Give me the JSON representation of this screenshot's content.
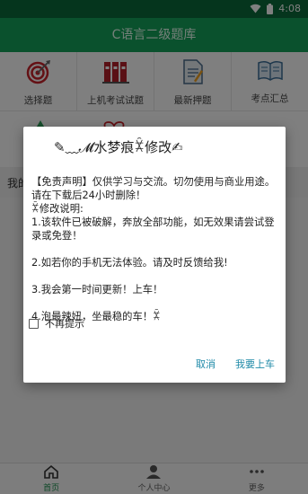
{
  "status_bar": {
    "time": "4:08"
  },
  "app_bar": {
    "title": "C语言二级题库"
  },
  "grid": [
    {
      "label": "选择题",
      "icon": "target-icon"
    },
    {
      "label": "上机考试试题",
      "icon": "books-icon"
    },
    {
      "label": "最新押题",
      "icon": "document-icon"
    },
    {
      "label": "考点汇总",
      "icon": "open-book-icon"
    }
  ],
  "mine_row": {
    "text": "我的"
  },
  "bottom_nav": [
    {
      "label": "首页",
      "icon": "home-icon",
      "active": true
    },
    {
      "label": "个人中心",
      "icon": "person-icon",
      "active": false
    },
    {
      "label": "更多",
      "icon": "more-icon",
      "active": false
    }
  ],
  "dialog": {
    "title": "✎﹏𝓜水梦痕ꁾ修改✍",
    "lines": [
      "【免责声明】仅供学习与交流。切勿使用与商业用途。请在下载后24小时删除！",
      "ꁾ修改说明:",
      "1.该软件已被破解，奔放全部功能，如无效果请尝试登录或免登！",
      "",
      "2.如若你的手机无法体验。请及时反馈给我!",
      "",
      "3.我会第一时间更新！上车！",
      "",
      "4.泡最辣妞，坐最稳的车！ꁾ"
    ],
    "checkbox_label": "不再提示",
    "cancel_label": "取消",
    "confirm_label": "我要上车"
  },
  "colors": {
    "accent_green": "#14a35a",
    "status_green": "#0b6b3a",
    "link_blue": "#1f8aa8"
  }
}
